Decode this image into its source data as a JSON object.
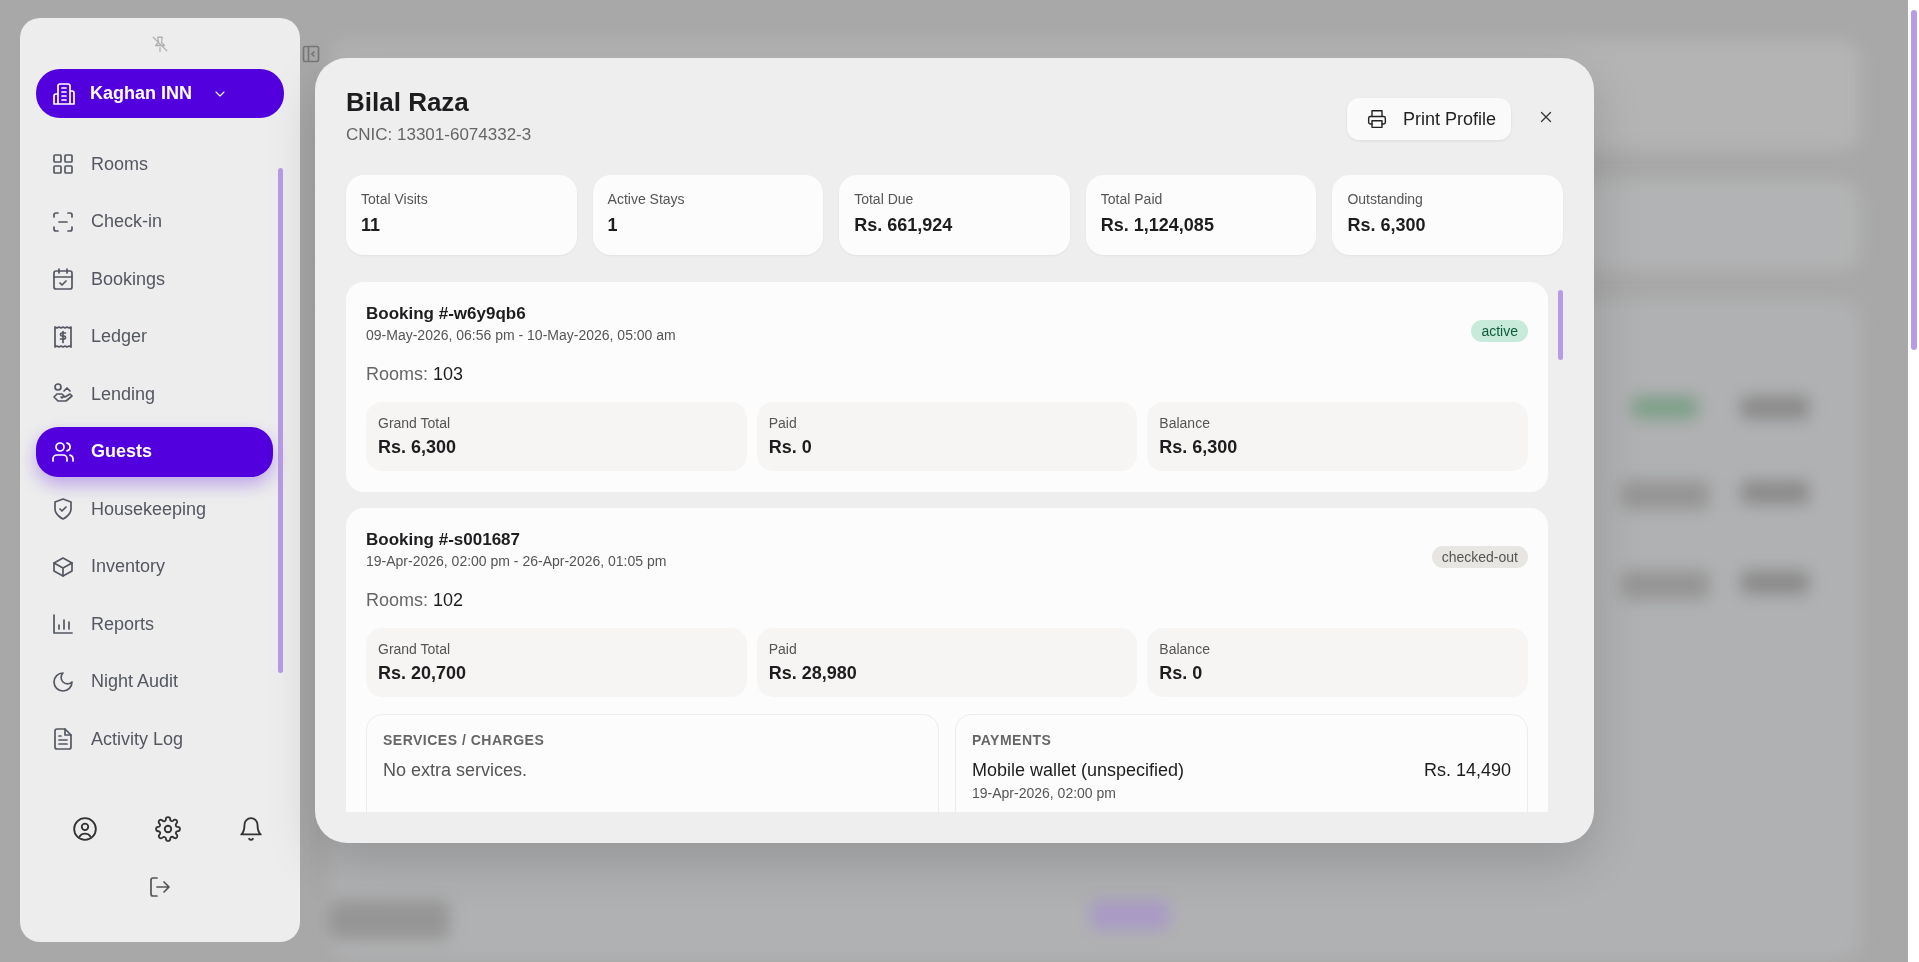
{
  "sidebar": {
    "brand": {
      "label": "Kaghan INN"
    },
    "items": [
      {
        "label": "Rooms",
        "selected": false
      },
      {
        "label": "Check-in",
        "selected": false
      },
      {
        "label": "Bookings",
        "selected": false
      },
      {
        "label": "Ledger",
        "selected": false
      },
      {
        "label": "Lending",
        "selected": false
      },
      {
        "label": "Guests",
        "selected": true
      },
      {
        "label": "Housekeeping",
        "selected": false
      },
      {
        "label": "Inventory",
        "selected": false
      },
      {
        "label": "Reports",
        "selected": false
      },
      {
        "label": "Night Audit",
        "selected": false
      },
      {
        "label": "Activity Log",
        "selected": false
      }
    ]
  },
  "modal": {
    "guest_name": "Bilal Raza",
    "cnic": "CNIC: 13301-6074332-3",
    "print_button": "Print Profile",
    "stats": [
      {
        "label": "Total Visits",
        "value": "11"
      },
      {
        "label": "Active Stays",
        "value": "1"
      },
      {
        "label": "Total Due",
        "value": "Rs. 661,924"
      },
      {
        "label": "Total Paid",
        "value": "Rs. 1,124,085"
      },
      {
        "label": "Outstanding",
        "value": "Rs. 6,300"
      }
    ],
    "bookings": [
      {
        "title": "Booking #-w6y9qb6",
        "dates": "09-May-2026, 06:56 pm - 10-May-2026, 05:00 am",
        "status": {
          "label": "active",
          "kind": "active"
        },
        "rooms_label": "Rooms:",
        "rooms": "103",
        "amounts": [
          {
            "label": "Grand Total",
            "value": "Rs. 6,300"
          },
          {
            "label": "Paid",
            "value": "Rs. 0"
          },
          {
            "label": "Balance",
            "value": "Rs. 6,300"
          }
        ]
      },
      {
        "title": "Booking #-s001687",
        "dates": "19-Apr-2026, 02:00 pm - 26-Apr-2026, 01:05 pm",
        "status": {
          "label": "checked-out",
          "kind": "closed"
        },
        "rooms_label": "Rooms:",
        "rooms": "102",
        "amounts": [
          {
            "label": "Grand Total",
            "value": "Rs. 20,700"
          },
          {
            "label": "Paid",
            "value": "Rs. 28,980"
          },
          {
            "label": "Balance",
            "value": "Rs. 0"
          }
        ],
        "services": {
          "title": "SERVICES / CHARGES",
          "empty_text": "No extra services."
        },
        "payments": {
          "title": "PAYMENTS",
          "items": [
            {
              "method": "Mobile wallet (unspecified)",
              "amount": "Rs. 14,490",
              "date": "19-Apr-2026, 02:00 pm"
            }
          ]
        }
      }
    ]
  }
}
